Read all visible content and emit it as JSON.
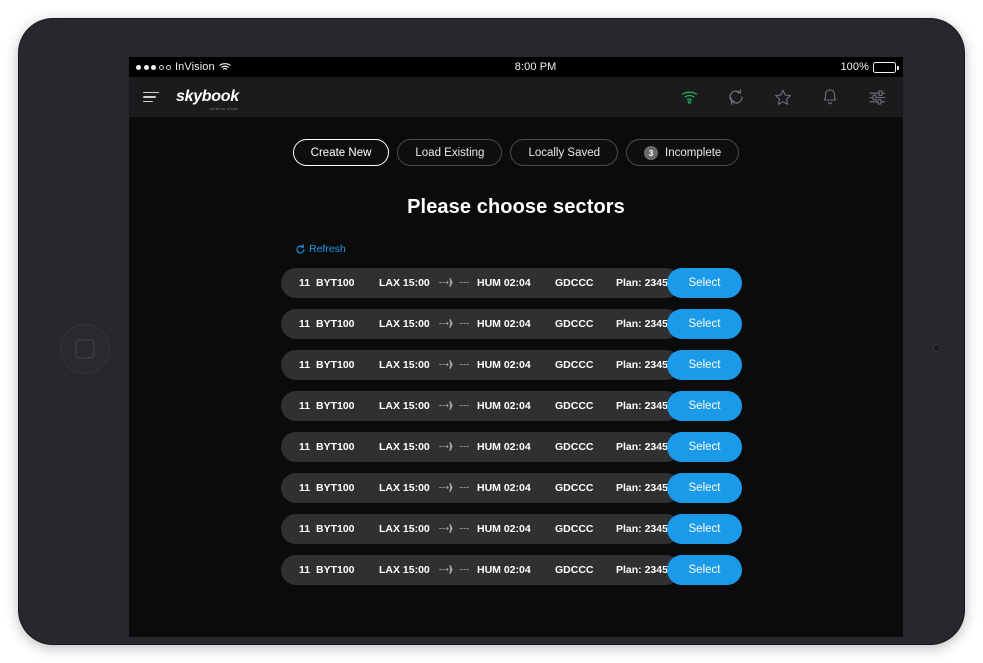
{
  "status_bar": {
    "carrier": "InVision",
    "signal_dots_filled": 3,
    "signal_dots_hollow": 2,
    "wifi_icon": "wifi-icon",
    "time": "8:00 PM",
    "battery_percent": "100%",
    "battery_icon": "battery-full-icon"
  },
  "header": {
    "menu_icon": "hamburger-menu-icon",
    "brand": "skybook",
    "brand_subtext": "aviation cloud",
    "actions": [
      {
        "name": "wifi-status-icon",
        "color": "#27ae60"
      },
      {
        "name": "sync-icon",
        "color": "#6f7175"
      },
      {
        "name": "star-icon",
        "color": "#6f7175"
      },
      {
        "name": "bell-icon",
        "color": "#6f7175"
      },
      {
        "name": "settings-sliders-icon",
        "color": "#6f7175"
      }
    ]
  },
  "tabs": [
    {
      "label": "Create New",
      "active": true,
      "badge": null
    },
    {
      "label": "Load Existing",
      "active": false,
      "badge": null
    },
    {
      "label": "Locally Saved",
      "active": false,
      "badge": null
    },
    {
      "label": "Incomplete",
      "active": false,
      "badge": "3"
    }
  ],
  "page_title": "Please choose sectors",
  "refresh": {
    "label": "Refresh",
    "icon": "refresh-circular-arrow-icon",
    "color": "#1a9ae8"
  },
  "sector_columns": [
    "seq",
    "flight",
    "departure",
    "arrival",
    "registration",
    "plan"
  ],
  "sectors": [
    {
      "seq": "11",
      "flight": "BYT100",
      "departure": "LAX 15:00",
      "arrival": "HUM 02:04",
      "registration": "GDCCC",
      "plan": "Plan: 2345",
      "select_label": "Select"
    },
    {
      "seq": "11",
      "flight": "BYT100",
      "departure": "LAX 15:00",
      "arrival": "HUM 02:04",
      "registration": "GDCCC",
      "plan": "Plan: 2345",
      "select_label": "Select"
    },
    {
      "seq": "11",
      "flight": "BYT100",
      "departure": "LAX 15:00",
      "arrival": "HUM 02:04",
      "registration": "GDCCC",
      "plan": "Plan: 2345",
      "select_label": "Select"
    },
    {
      "seq": "11",
      "flight": "BYT100",
      "departure": "LAX 15:00",
      "arrival": "HUM 02:04",
      "registration": "GDCCC",
      "plan": "Plan: 2345",
      "select_label": "Select"
    },
    {
      "seq": "11",
      "flight": "BYT100",
      "departure": "LAX 15:00",
      "arrival": "HUM 02:04",
      "registration": "GDCCC",
      "plan": "Plan: 2345",
      "select_label": "Select"
    },
    {
      "seq": "11",
      "flight": "BYT100",
      "departure": "LAX 15:00",
      "arrival": "HUM 02:04",
      "registration": "GDCCC",
      "plan": "Plan: 2345",
      "select_label": "Select"
    },
    {
      "seq": "11",
      "flight": "BYT100",
      "departure": "LAX 15:00",
      "arrival": "HUM 02:04",
      "registration": "GDCCC",
      "plan": "Plan: 2345",
      "select_label": "Select"
    },
    {
      "seq": "11",
      "flight": "BYT100",
      "departure": "LAX 15:00",
      "arrival": "HUM 02:04",
      "registration": "GDCCC",
      "plan": "Plan: 2345",
      "select_label": "Select"
    }
  ],
  "colors": {
    "accent_blue": "#1a9ae8",
    "row_background": "#303032",
    "screen_background": "#0b0b0c",
    "header_background": "#1b1b1d",
    "wifi_green": "#27ae60"
  }
}
